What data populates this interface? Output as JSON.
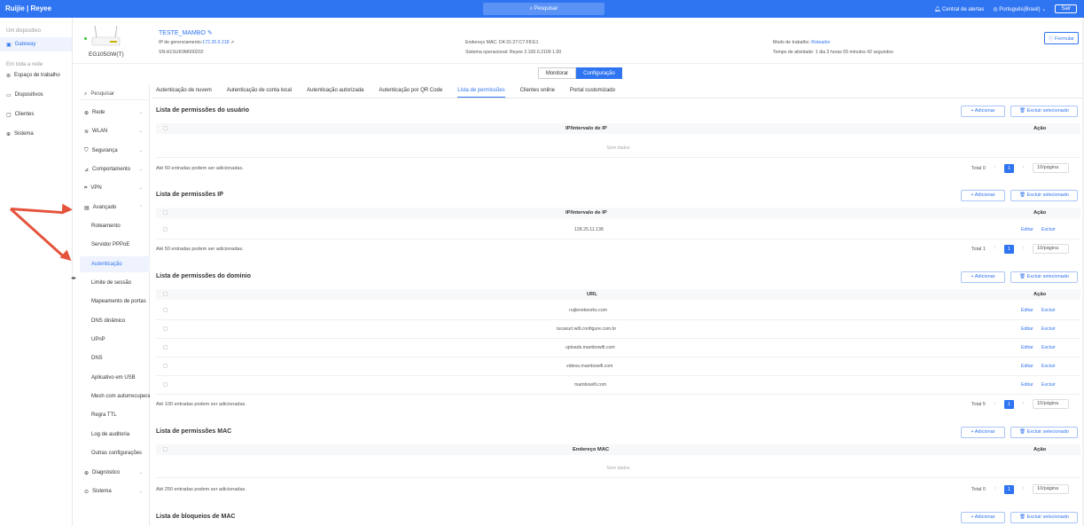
{
  "top": {
    "logo": "Ruijie | Reyee",
    "search": "Pesquisar",
    "alerts": "Central de alertas",
    "language": "Português(Brasil)",
    "logout": "Sair"
  },
  "leftnav": {
    "section1": "Um dispositivo",
    "gateway": "Gateway",
    "section2": "Em toda a rede",
    "items": [
      "Espaço de trabalho",
      "Dispositivos",
      "Clientes",
      "Sistema"
    ]
  },
  "device": {
    "name": "TESTE_MAMBO",
    "model": "EG105GW(T)",
    "ip_label": "IP de gerenciamento:",
    "ip": "172.26.9.218",
    "sn": "SN:H1SUK9M000202",
    "mac": "Endereço MAC: D4:31:27:C7:F8:E1",
    "os": "Sistema operacional: Reyee 2.100.0.2109 1.00",
    "mode_label": "Modo de trabalho:",
    "mode": "Roteador",
    "uptime": "Tempo de atividade: 1 dia 3 horas 55 minutos 42 segundos",
    "formular": "Formular"
  },
  "modetabs": {
    "monitor": "Monitorar",
    "config": "Configuração"
  },
  "subnav": {
    "search": "Pesquisar",
    "groups": [
      "Rede",
      "WLAN",
      "Segurança",
      "Comportamento",
      "VPN",
      "Avançado"
    ],
    "children": [
      "Roteamento",
      "Servidor PPPoE",
      "Autenticação",
      "Limite de sessão",
      "Mapeamento de portas",
      "DNS dinâmico",
      "UPnP",
      "DNS",
      "Aplicativo em USB",
      "Mesh com autorrecuperação",
      "Regra TTL",
      "Log de auditoria",
      "Outras configurações"
    ],
    "bottom": [
      "Diagnóstico",
      "Sistema"
    ]
  },
  "tabs": [
    "Autenticação de nuvem",
    "Autenticação de conta local",
    "Autenticação autorizada",
    "Autenticação por QR Code",
    "Lista de permissões",
    "Clientes online",
    "Portal customizado"
  ],
  "common": {
    "add": "+ Adicionar",
    "delete_sel": "Excluir selecionado",
    "action": "Ação",
    "no_data": "Sem dados",
    "edit": "Editar",
    "delete": "Excluir",
    "per_page": "10/página"
  },
  "sections": [
    {
      "title": "Lista de permissões do usuário",
      "column": "IP/Intervalo de IP",
      "rows": [],
      "footer": "Até 50 entradas podem ser adicionadas.",
      "total": "Total 0"
    },
    {
      "title": "Lista de permissões IP",
      "column": "IP/Intervalo de IP",
      "rows": [
        "128.25.11.138"
      ],
      "footer": "Até 50 entradas podem ser adicionadas.",
      "total": "Total 1"
    },
    {
      "title": "Lista de permissões do domínio",
      "column": "URL",
      "rows": [
        "ruijienetworks.com",
        "tucasurl.wifi.configure.com.br",
        "uploads.mambowifi.com",
        "videos.mambowifi.com",
        "mambowifi.com"
      ],
      "footer": "Até 100 entradas podem ser adicionadas.",
      "total": "Total 5"
    },
    {
      "title": "Lista de permissões MAC",
      "column": "Endereço MAC",
      "rows": [],
      "footer": "Até 250 entradas podem ser adicionadas.",
      "total": "Total 0"
    },
    {
      "title": "Lista de bloqueios de MAC"
    }
  ],
  "page_number": "1",
  "colors": {
    "accent": "#2f74f1",
    "arrow": "#e5533c"
  }
}
